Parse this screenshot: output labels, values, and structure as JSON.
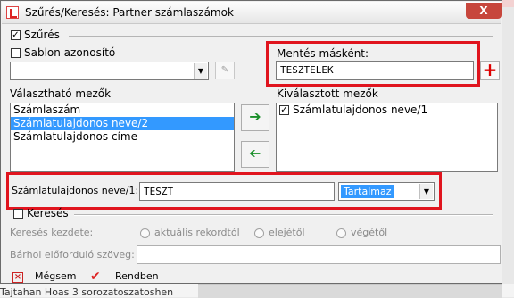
{
  "window": {
    "title": "Szűrés/Keresés: Partner számlaszámok",
    "close_label": "X"
  },
  "filter": {
    "section_label": "Szűrés",
    "section_checked": true,
    "template_label": "Sablon azonosító",
    "template_value": "",
    "save_as_label": "Mentés másként:",
    "save_as_value": "TESZTELEK"
  },
  "available_fields": {
    "label": "Választható mezők",
    "items": [
      "Számlaszám",
      "Számlatulajdonos neve/2",
      "Számlatulajdonos címe"
    ],
    "selected_index": 1
  },
  "selected_fields": {
    "label": "Kiválasztott mezők",
    "items": [
      {
        "label": "Számlatulajdonos neve/1",
        "checked": true
      }
    ]
  },
  "condition": {
    "field_label": "Számlatulajdonos neve/1:",
    "value": "TESZT",
    "operator": "Tartalmaz"
  },
  "search": {
    "section_label": "Keresés",
    "start_label": "Keresés kezdete:",
    "options": [
      "aktuális rekordtól",
      "elejétől",
      "végétől"
    ],
    "anywhere_label": "Bárhol előforduló szöveg:"
  },
  "buttons": {
    "cancel": "Mégsem",
    "ok": "Rendben"
  },
  "background": {
    "row_text": "Tajtahan  Hoas 3 sorozatoszatoshen"
  },
  "colors": {
    "highlight": "#e0141e",
    "selection": "#3399ff"
  }
}
